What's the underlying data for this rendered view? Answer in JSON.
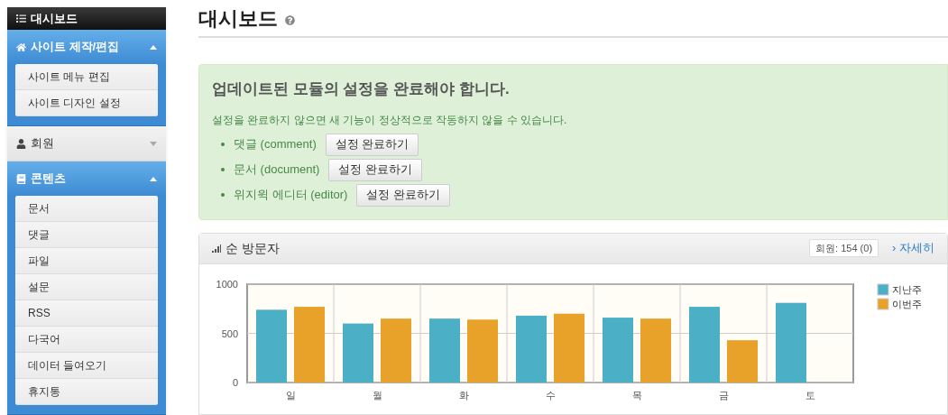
{
  "sidebar": {
    "title": "대시보드",
    "groups": [
      {
        "label": "사이트 제작/편집",
        "expanded": true,
        "items": [
          "사이트 메뉴 편집",
          "사이트 디자인 설정"
        ]
      },
      {
        "label": "회원",
        "expanded": false
      },
      {
        "label": "콘텐츠",
        "expanded": true,
        "items": [
          "문서",
          "댓글",
          "파일",
          "설문",
          "RSS",
          "다국어",
          "데이터 들여오기",
          "휴지통"
        ]
      }
    ]
  },
  "page": {
    "title": "대시보드"
  },
  "alert": {
    "title": "업데이트된 모듈의 설정을 완료해야 합니다.",
    "message": "설정을 완료하지 않으면 새 기능이 정상적으로 작동하지 않을 수 있습니다.",
    "items": [
      {
        "label": "댓글 (comment)",
        "button": "설정 완료하기"
      },
      {
        "label": "문서 (document)",
        "button": "설정 완료하기"
      },
      {
        "label": "위지윅 에디터 (editor)",
        "button": "설정 완료하기"
      }
    ]
  },
  "visitors": {
    "title": "순 방문자",
    "badge": "회원: 154 (0)",
    "link": "› 자세히",
    "chart_data": {
      "type": "bar",
      "legend": "right",
      "categories": [
        "일",
        "월",
        "화",
        "수",
        "목",
        "금",
        "토"
      ],
      "ylim": [
        0,
        1000
      ],
      "yticks": [
        0,
        500,
        1000
      ],
      "series": [
        {
          "name": "지난주",
          "color": "#4bb0c6",
          "values": [
            740,
            600,
            650,
            680,
            660,
            770,
            810
          ]
        },
        {
          "name": "이번주",
          "color": "#e8a22a",
          "values": [
            770,
            650,
            640,
            700,
            650,
            430,
            null
          ]
        }
      ]
    }
  }
}
